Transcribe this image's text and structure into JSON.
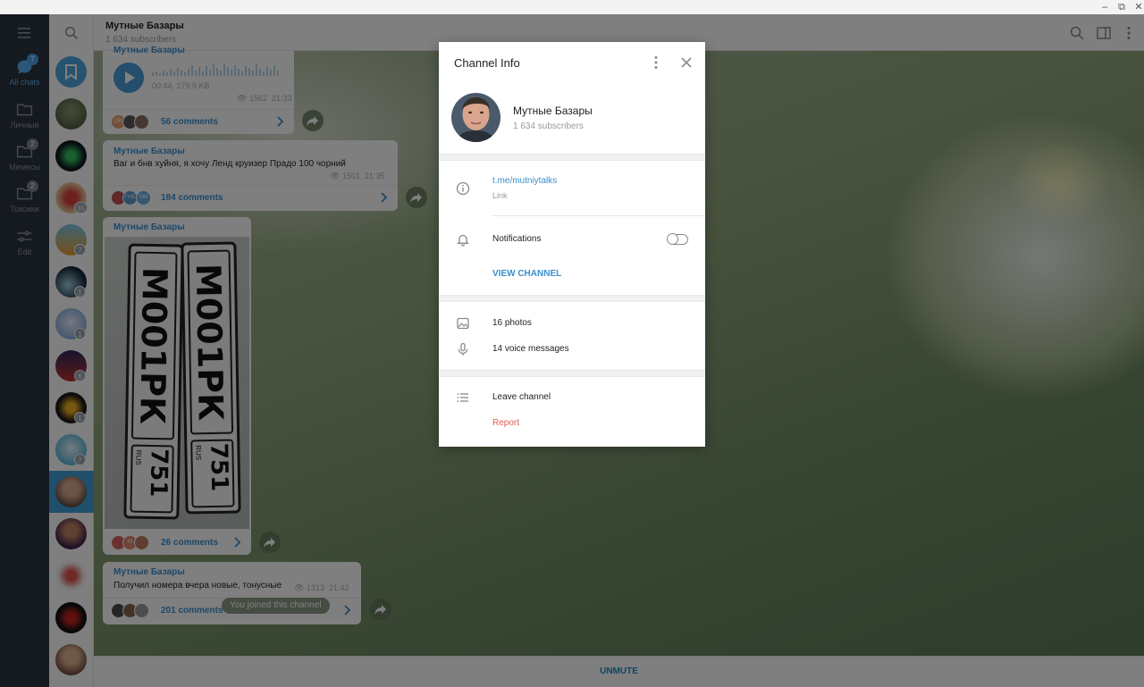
{
  "sidebar": {
    "folders": [
      {
        "label": "All chats",
        "badge": "7",
        "active": true
      },
      {
        "label": "Личные",
        "badge": ""
      },
      {
        "label": "Мемесы",
        "badge": "2"
      },
      {
        "label": "Токсики",
        "badge": "2"
      },
      {
        "label": "Edit",
        "badge": ""
      }
    ]
  },
  "chatlist": {
    "badges": [
      "",
      "",
      "",
      "35",
      "7",
      "1",
      "1",
      "6",
      "1",
      "7",
      "",
      "",
      "",
      "",
      ""
    ]
  },
  "header": {
    "title": "Мутные Базары",
    "subtitle": "1 634 subscribers"
  },
  "messages": {
    "voice": {
      "author": "Мутные Базары",
      "duration_size": "00:44, 179.9 KB",
      "views": "1562",
      "time": "21:33",
      "comments": "56 comments",
      "mini_avatars": [
        "OK",
        "",
        ""
      ]
    },
    "msg2": {
      "author": "Мутные Базары",
      "text": "Ваг и бнв хуйня, я хочу Ленд круизер Прадо 100 чорний",
      "views": "1501",
      "time": "21:35",
      "comments": "184 comments",
      "mini_avatars": [
        "",
        "ГНБ",
        "DM"
      ]
    },
    "photo": {
      "author": "Мутные Базары",
      "comments": "26 comments",
      "plate_text": "М001РК",
      "plate_region": "751",
      "plate_country": "RUS",
      "mini_avatars": [
        "",
        "M",
        ""
      ]
    },
    "msg4": {
      "author": "Мутные Базары",
      "text": "Получил номера вчера новые, тонусные",
      "views": "1313",
      "time": "21:42",
      "comments": "201 comments",
      "mini_avatars": [
        "",
        "",
        ""
      ]
    },
    "service": "You joined this channel"
  },
  "bottom": {
    "unmute": "UNMUTE"
  },
  "dialog": {
    "title": "Channel Info",
    "name": "Мутные Базары",
    "subscribers": "1 634 subscribers",
    "link": "t.me/mutniytalks",
    "link_label": "Link",
    "notifications": "Notifications",
    "notifications_enabled": false,
    "view_channel": "VIEW CHANNEL",
    "photos": "16 photos",
    "voice_messages": "14 voice messages",
    "leave": "Leave channel",
    "report": "Report"
  },
  "colors": {
    "accent": "#3a8fce",
    "sidebar_bg": "#2a3440",
    "active_chat": "#419fd9",
    "report": "#e25c4c"
  }
}
